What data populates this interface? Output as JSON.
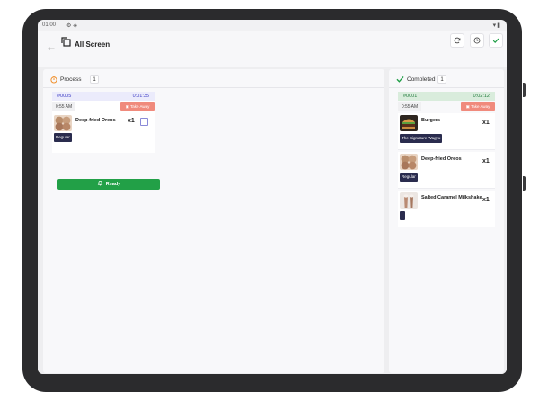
{
  "status_bar": {
    "time": "01:00",
    "icons": [
      "settings-icon",
      "notification-icon"
    ],
    "right_icons": [
      "wifi-icon",
      "battery-icon"
    ]
  },
  "header": {
    "title": "All Screen",
    "buttons": [
      "refresh",
      "history",
      "confirm"
    ]
  },
  "colors": {
    "ready_green": "#22a047",
    "take_away": "#f08a7c",
    "process_header": "#ebebfb",
    "completed_header": "#d9ecdc",
    "modifier": "#2a2c4e"
  },
  "process": {
    "label": "Process",
    "count": "1",
    "order": {
      "number": "#0005",
      "timer": "0:01:35",
      "time": "0:55 AM",
      "type": "Take Away",
      "item": {
        "name": "Deep-fried Oreos",
        "qty": "x1",
        "modifier": "Regular"
      },
      "ready_label": "Ready"
    }
  },
  "completed": {
    "label": "Completed",
    "count": "1",
    "order": {
      "number": "#0001",
      "timer": "0:02:12",
      "time": "0:55 AM",
      "type": "Take Away",
      "items": [
        {
          "name": "Burgers",
          "qty": "x1",
          "modifier": "The Signature Wagyu"
        },
        {
          "name": "Deep-fried Oreos",
          "qty": "x1",
          "modifier": "Regular"
        },
        {
          "name": "Salted Caramel Milkshake",
          "qty": "x1",
          "modifier": ""
        }
      ]
    }
  }
}
